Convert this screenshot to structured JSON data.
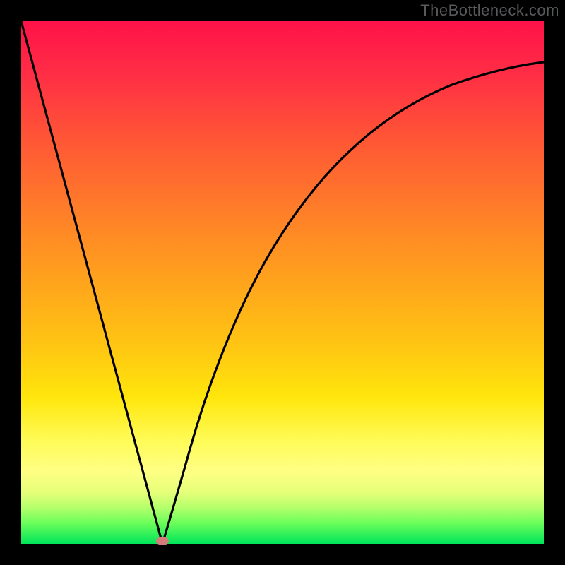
{
  "watermark": "TheBottleneck.com",
  "chart_data": {
    "type": "line",
    "title": "",
    "xlabel": "",
    "ylabel": "",
    "xlim": [
      0,
      100
    ],
    "ylim": [
      0,
      100
    ],
    "grid": false,
    "legend": false,
    "series": [
      {
        "name": "left-branch",
        "x": [
          0,
          7.7,
          15.4,
          23.1,
          27.0
        ],
        "values": [
          100,
          68,
          36,
          6,
          0
        ]
      },
      {
        "name": "right-branch",
        "x": [
          27.0,
          30.0,
          35.0,
          40.0,
          45.0,
          50.0,
          55.0,
          60.0,
          70.0,
          80.0,
          90.0,
          100.0
        ],
        "values": [
          0,
          10,
          27,
          42,
          53,
          62,
          69,
          74,
          81,
          86,
          89,
          92
        ]
      }
    ],
    "annotations": [
      {
        "name": "minimum-marker",
        "x": 27.0,
        "y": 0
      }
    ],
    "background_gradient": {
      "top": "#ff1249",
      "mid": "#ffc812",
      "bottom": "#00e45a"
    }
  }
}
